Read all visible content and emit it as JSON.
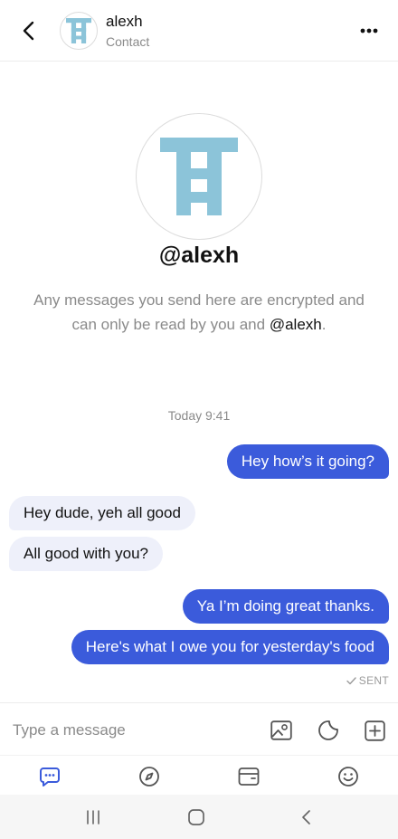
{
  "header": {
    "name": "alexh",
    "subtitle": "Contact",
    "back_icon": "back-chevron-icon",
    "more_icon": "more-dots-icon"
  },
  "profile": {
    "handle": "@alexh",
    "note_prefix": "Any messages you send here are encrypted and can only be read by you and",
    "note_handle": "@alexh",
    "note_suffix": "."
  },
  "conversation": {
    "timestamp": "Today 9:41",
    "messages": [
      {
        "from": "me",
        "text": "Hey how’s it going?"
      },
      {
        "from": "them",
        "text": "Hey dude, yeh all good"
      },
      {
        "from": "them",
        "text": "All good with you?"
      },
      {
        "from": "me",
        "text": "Ya I’m doing great thanks."
      },
      {
        "from": "me",
        "text": "Here's what I owe you for yesterday's food"
      }
    ],
    "status": "SENT"
  },
  "composer": {
    "placeholder": "Type a message",
    "icons": [
      "image-icon",
      "sticker-icon",
      "add-icon"
    ]
  },
  "tabs": [
    {
      "name": "chat",
      "icon": "chat-icon",
      "active": true
    },
    {
      "name": "explore",
      "icon": "compass-icon",
      "active": false
    },
    {
      "name": "wallet",
      "icon": "wallet-icon",
      "active": false
    },
    {
      "name": "profile",
      "icon": "smiley-icon",
      "active": false
    }
  ],
  "colors": {
    "accent": "#3b5bdb",
    "logo": "#8cc4d9",
    "incoming_bubble": "#eef0fa",
    "muted_text": "#8a8a8a"
  }
}
